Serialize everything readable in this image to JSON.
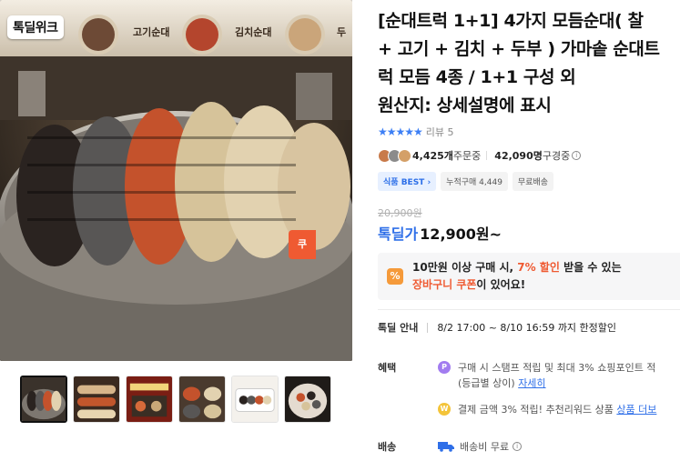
{
  "gallery": {
    "brand_logo": "톡딜위크",
    "sign_labels": [
      "고기순대",
      "김치순대",
      "두"
    ],
    "thumbnail_count": 6
  },
  "product": {
    "title": "[순대트럭 1+1] 4가지 모듬순대( 찰 + 고기 + 김치 + 두부 ) 가마솥 순대트럭 모듬 4종 / 1+1 구성 외\n원산지: 상세설명에 표시",
    "stars": "★★★★★",
    "review_label": "리뷰 5"
  },
  "stats": {
    "order_count": "4,425개",
    "order_suffix": " 주문중",
    "subscriber_count": "42,090명",
    "subscriber_suffix": " 구경중",
    "info_icon": "i"
  },
  "badges": [
    "식품 BEST",
    "누적구매 4,449",
    "무료배송"
  ],
  "pricing": {
    "original_price": "20,900원",
    "deal_label": "톡딜가",
    "deal_price": "12,900원",
    "deal_suffix": "~",
    "side_button": "쿠"
  },
  "coupon": {
    "icon": "%",
    "line1_prefix": "10만원 이상 구매 시, ",
    "line1_highlight": "7% 할인",
    "line1_suffix": " 받을 수 있는",
    "line2_highlight": "장바구니 쿠폰",
    "line2_suffix": "이 있어요!"
  },
  "deal_info": {
    "label": "톡딜 안내",
    "period": "8/2 17:00 ~ 8/10 16:59 까지 한정할인"
  },
  "benefits": {
    "label": "혜택",
    "items": [
      {
        "icon": "P",
        "text": "구매 시 스탬프 적립 및 최대 3% 쇼핑포인트 적",
        "text2": "(등급별 상이) ",
        "link": "자세히"
      },
      {
        "icon": "W",
        "text": "결제 금액 3% 적립! 추천리워드 상품 ",
        "link": "상품 더보"
      }
    ]
  },
  "shipping": {
    "label": "배송",
    "text": "배송비 무료"
  },
  "colors": {
    "accent_blue": "#2f6fe8",
    "accent_orange": "#ef5a32",
    "star_blue": "#3d7ff5"
  }
}
